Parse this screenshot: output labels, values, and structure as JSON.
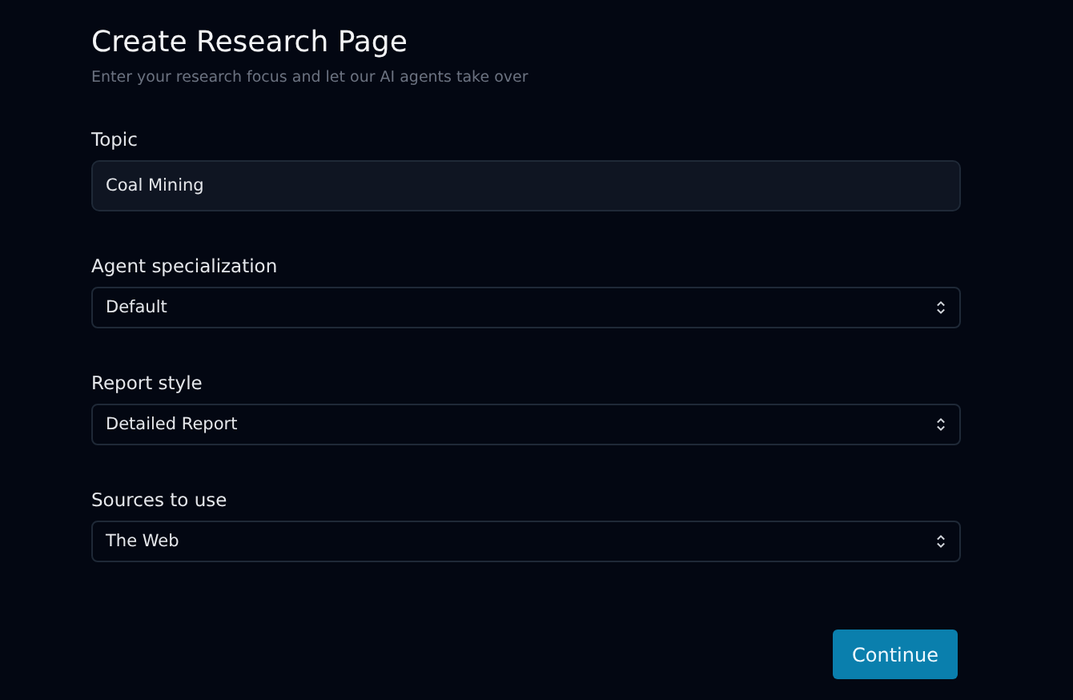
{
  "header": {
    "title": "Create Research Page",
    "subtitle": "Enter your research focus and let our AI agents take over"
  },
  "fields": [
    {
      "kind": "text",
      "label": "Topic",
      "value": "Coal Mining"
    },
    {
      "kind": "select",
      "label": "Agent specialization",
      "value": "Default"
    },
    {
      "kind": "select",
      "label": "Report style",
      "value": "Detailed Report"
    },
    {
      "kind": "select",
      "label": "Sources to use",
      "value": "The Web"
    }
  ],
  "buttons": [
    "Continue"
  ]
}
